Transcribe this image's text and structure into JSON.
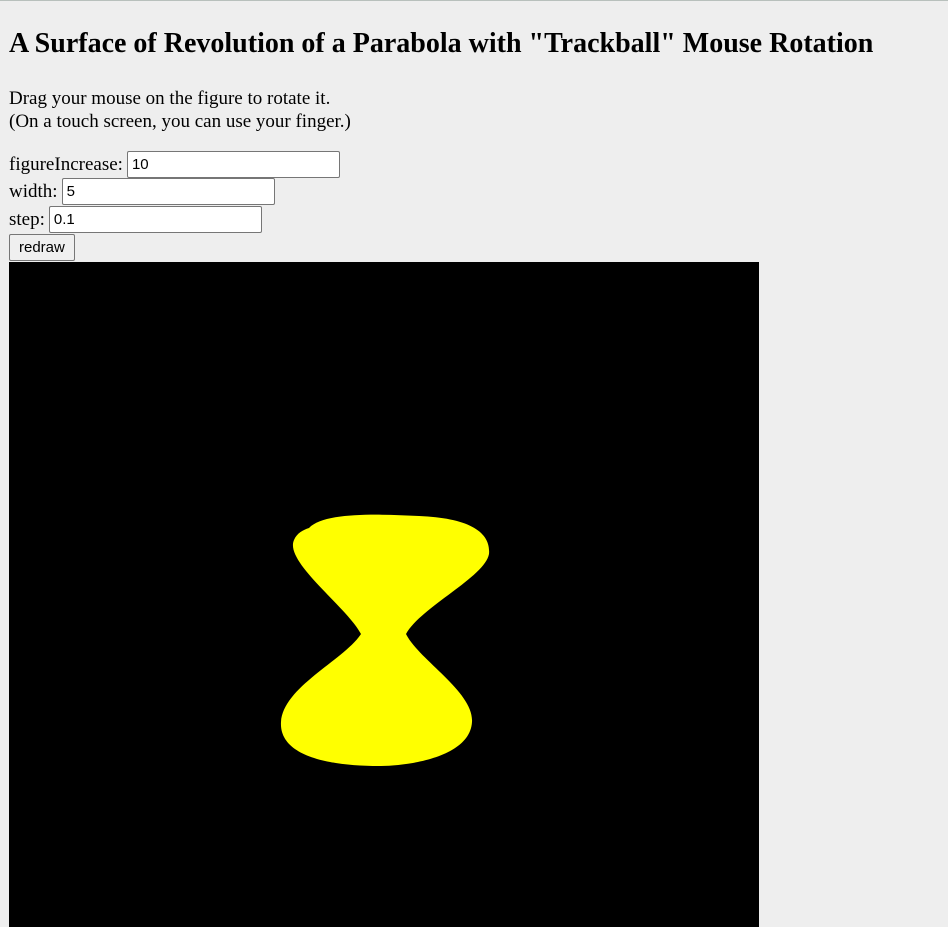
{
  "page": {
    "title": "A Surface of Revolution of a Parabola with \"Trackball\" Mouse Rotation",
    "instruction_line1": "Drag your mouse on the figure to rotate it.",
    "instruction_line2": "(On a touch screen, you can use your finger.)"
  },
  "controls": {
    "figure_increase": {
      "label": "figureIncrease:",
      "value": "10"
    },
    "width": {
      "label": "width:",
      "value": "5"
    },
    "step": {
      "label": "step:",
      "value": "0.1"
    },
    "redraw_label": "redraw"
  },
  "canvas": {
    "background": "#000000",
    "surface_color": "#ffff00"
  }
}
